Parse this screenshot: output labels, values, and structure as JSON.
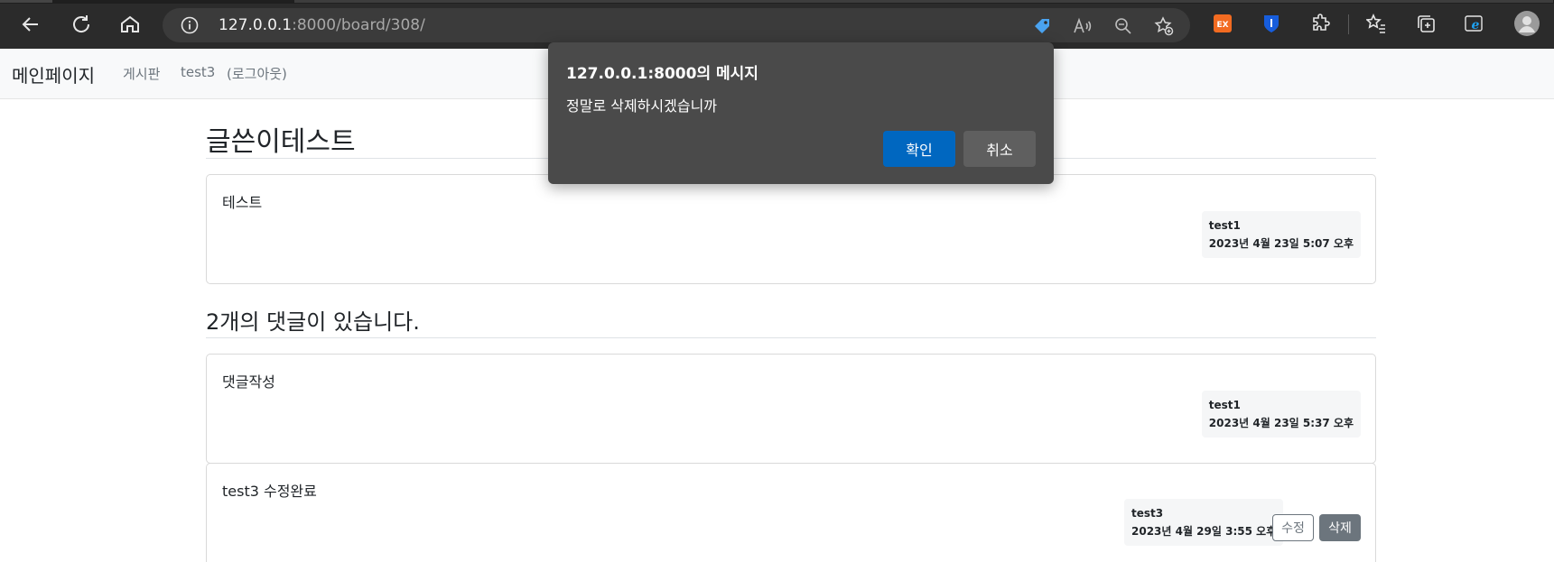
{
  "browser": {
    "url_host": "127.0.0.1",
    "url_rest": ":8000/board/308/",
    "colors": {
      "toolbar": "#2b2b2b",
      "omnibox": "#3b3b3b"
    }
  },
  "sitenav": {
    "brand": "메인페이지",
    "links": [
      "게시판",
      "test3",
      "(로그아웃)"
    ]
  },
  "post": {
    "title": "글쓴이테스트",
    "body": "테스트",
    "author": "test1",
    "date": "2023년 4월 23일 5:07 오후"
  },
  "comments": {
    "heading": "2개의 댓글이 있습니다.",
    "items": [
      {
        "body": "댓글작성",
        "author": "test1",
        "date": "2023년 4월 23일 5:37 오후"
      },
      {
        "body": "test3 수정완료",
        "author": "test3",
        "date": "2023년 4월 29일 3:55 오후",
        "edit_label": "수정",
        "delete_label": "삭제"
      }
    ]
  },
  "dialog": {
    "title": "127.0.0.1:8000의 메시지",
    "message": "정말로 삭제하시겠습니까",
    "ok_label": "확인",
    "cancel_label": "취소",
    "colors": {
      "ok": "#0067c0",
      "cancel": "#5f5f5f"
    }
  }
}
